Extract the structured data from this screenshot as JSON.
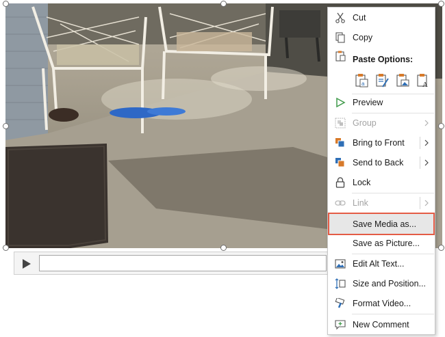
{
  "menu": {
    "cut": "Cut",
    "copy": "Copy",
    "paste_options": "Paste Options:",
    "preview": "Preview",
    "group": "Group",
    "bring_to_front": "Bring to Front",
    "send_to_back": "Send to Back",
    "lock": "Lock",
    "link": "Link",
    "save_media_as": "Save Media as...",
    "save_as_picture": "Save as Picture...",
    "edit_alt_text": "Edit Alt Text...",
    "size_and_position": "Size and Position...",
    "format_video": "Format Video...",
    "new_comment": "New Comment"
  },
  "paste_option_icons": [
    "paste-keep-source-icon",
    "paste-merge-format-icon",
    "paste-picture-icon",
    "paste-text-only-icon"
  ],
  "colors": {
    "highlight_outline": "#e45b45",
    "highlight_fill": "#e7e7e7",
    "icon_blue": "#2f6fb6",
    "icon_orange": "#d77a2a",
    "preview_green": "#3f9a4a"
  },
  "player": {
    "progress": 0
  }
}
